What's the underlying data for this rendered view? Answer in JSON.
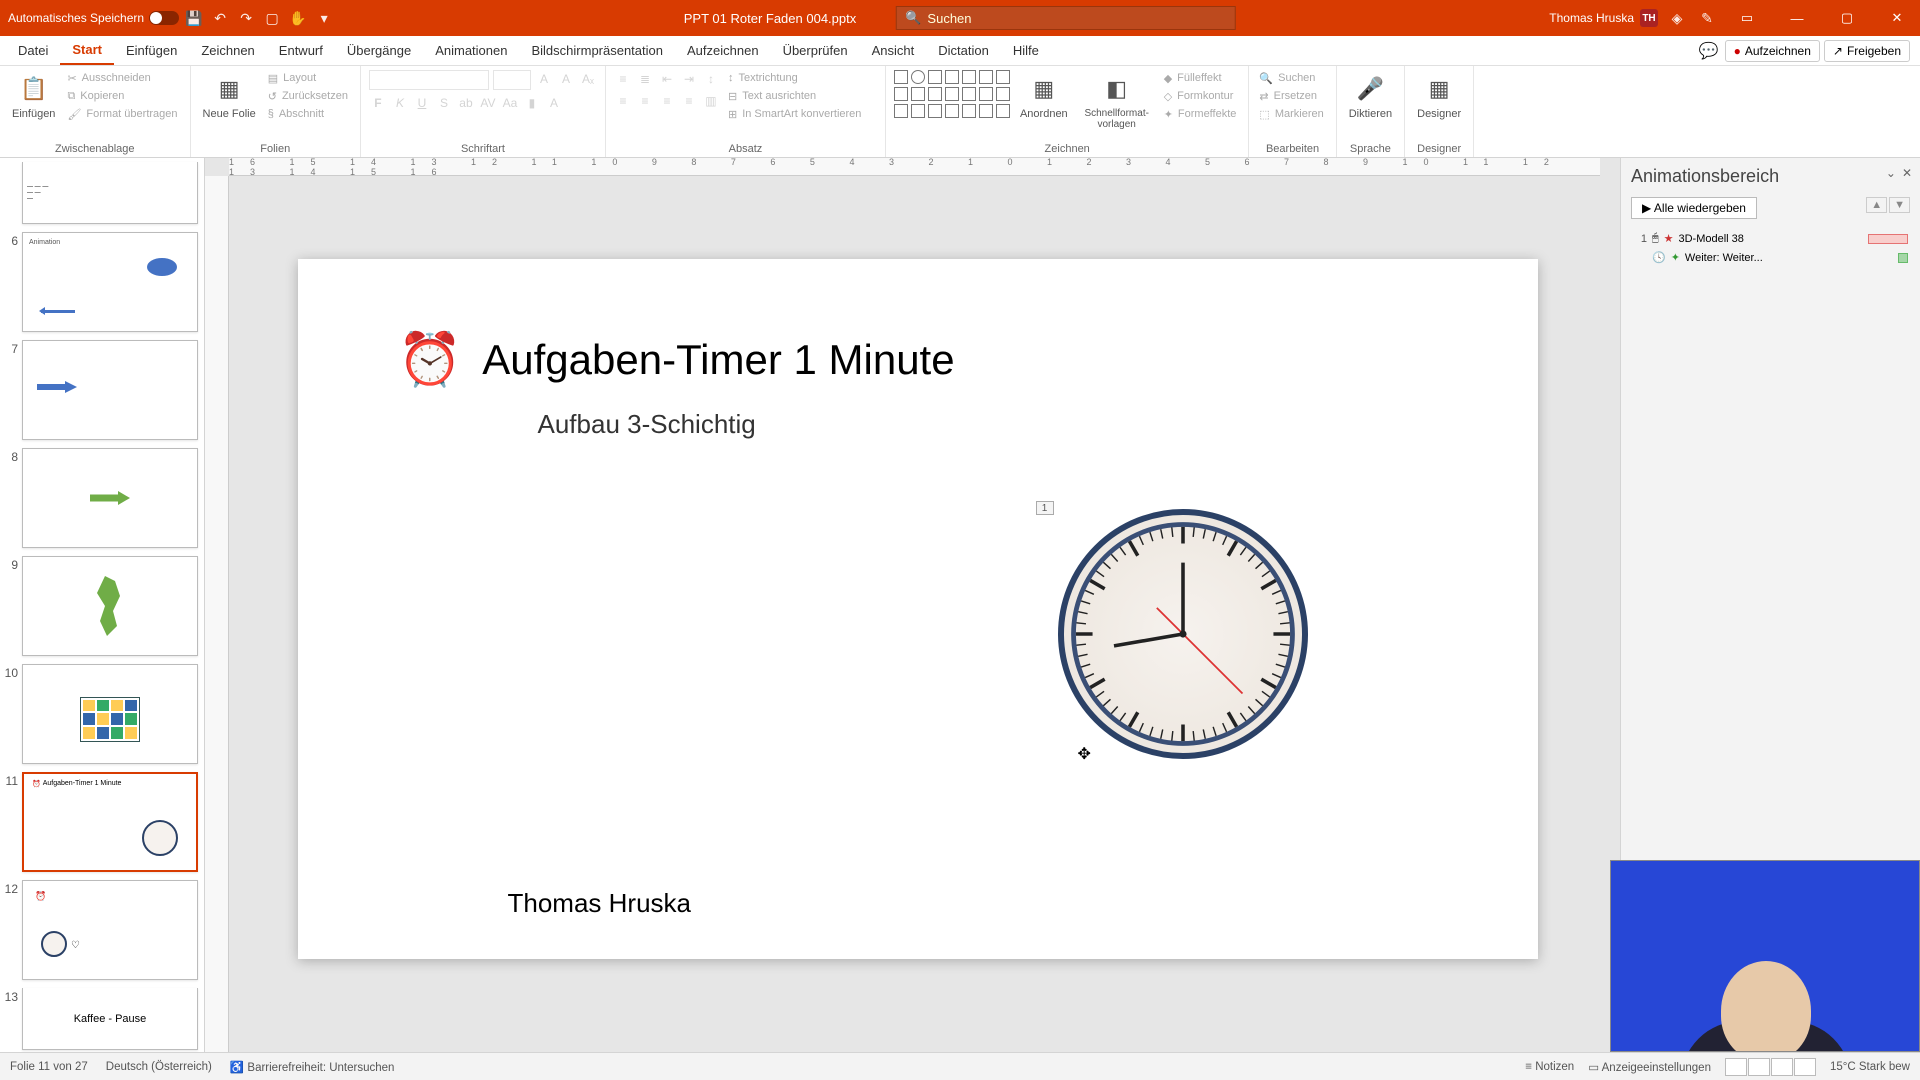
{
  "titlebar": {
    "autosave_label": "Automatisches Speichern",
    "filename": "PPT 01 Roter Faden 004.pptx",
    "search_placeholder": "Suchen",
    "user_name": "Thomas Hruska",
    "user_initials": "TH"
  },
  "ribbon_tabs": [
    "Datei",
    "Start",
    "Einfügen",
    "Zeichnen",
    "Entwurf",
    "Übergänge",
    "Animationen",
    "Bildschirmpräsentation",
    "Aufzeichnen",
    "Überprüfen",
    "Ansicht",
    "Dictation",
    "Hilfe"
  ],
  "ribbon_active_tab": "Start",
  "ribbon_right": {
    "record": "Aufzeichnen",
    "share": "Freigeben"
  },
  "ribbon_groups": {
    "clipboard": {
      "label": "Zwischenablage",
      "paste": "Einfügen",
      "cut": "Ausschneiden",
      "copy": "Kopieren",
      "format": "Format übertragen"
    },
    "slides": {
      "label": "Folien",
      "new": "Neue Folie",
      "layout": "Layout",
      "reset": "Zurücksetzen",
      "section": "Abschnitt"
    },
    "font": {
      "label": "Schriftart"
    },
    "paragraph": {
      "label": "Absatz",
      "textdir": "Textrichtung",
      "align": "Text ausrichten",
      "smartart": "In SmartArt konvertieren"
    },
    "drawing": {
      "label": "Zeichnen",
      "arrange": "Anordnen",
      "quick": "Schnellformat-vorlagen",
      "fill": "Fülleffekt",
      "outline": "Formkontur",
      "effects": "Formeffekte"
    },
    "editing": {
      "label": "Bearbeiten",
      "find": "Suchen",
      "replace": "Ersetzen",
      "select": "Markieren"
    },
    "voice": {
      "label": "Sprache",
      "dictate": "Diktieren"
    },
    "designer": {
      "label": "Designer",
      "btn": "Designer"
    }
  },
  "thumbnails": [
    {
      "n": "",
      "sel": false,
      "kind": "text"
    },
    {
      "n": "6",
      "sel": false,
      "kind": "ellipse"
    },
    {
      "n": "7",
      "sel": false,
      "kind": "arrow-blue"
    },
    {
      "n": "8",
      "sel": false,
      "kind": "arrow-green"
    },
    {
      "n": "9",
      "sel": false,
      "kind": "map"
    },
    {
      "n": "10",
      "sel": false,
      "kind": "diagram"
    },
    {
      "n": "11",
      "sel": true,
      "kind": "clock"
    },
    {
      "n": "12",
      "sel": false,
      "kind": "clock-small"
    },
    {
      "n": "13",
      "sel": false,
      "kind": "script"
    }
  ],
  "slide": {
    "title": "Aufgaben-Timer 1 Minute",
    "subtitle": "Aufbau 3-Schichtig",
    "author": "Thomas Hruska",
    "anim_index": "1"
  },
  "animpane": {
    "title": "Animationsbereich",
    "play_all": "Alle wiedergeben",
    "items": [
      {
        "idx": "1",
        "label": "3D-Modell 38",
        "bar": "red"
      },
      {
        "idx": "",
        "label": "Weiter: Weiter...",
        "bar": "green"
      }
    ]
  },
  "status": {
    "slide_of": "Folie 11 von 27",
    "lang": "Deutsch (Österreich)",
    "access": "Barrierefreiheit: Untersuchen",
    "notes": "Notizen",
    "display": "Anzeigeeinstellungen",
    "weather": "15°C  Stark bew"
  },
  "thumb13_script": "Kaffee - Pause"
}
